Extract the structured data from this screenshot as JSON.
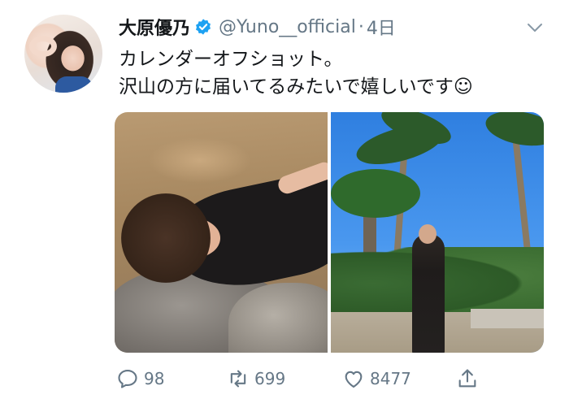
{
  "tweet": {
    "author": {
      "display_name": "大原優乃",
      "handle": "@Yuno__official",
      "verified": true
    },
    "separator": "·",
    "timestamp": "4日",
    "text_lines": [
      "カレンダーオフショット。",
      "沢山の方に届いてるみたいで嬉しいです☺"
    ],
    "media": {
      "count": 2
    },
    "actions": {
      "reply_count": "98",
      "retweet_count": "699",
      "like_count": "8477"
    }
  },
  "colors": {
    "verified_blue": "#1da1f2",
    "secondary_text": "#657786",
    "primary_text": "#14171a"
  },
  "icons": {
    "reply": "reply-icon",
    "retweet": "retweet-icon",
    "like": "heart-icon",
    "share": "share-icon",
    "menu": "chevron-down-icon",
    "verified": "verified-badge-icon"
  }
}
